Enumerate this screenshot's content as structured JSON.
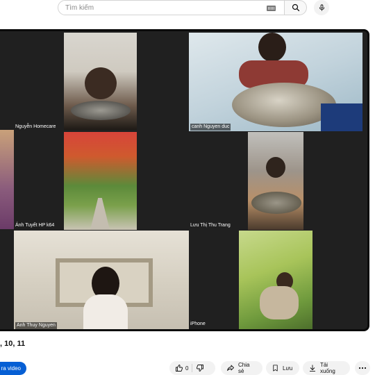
{
  "search": {
    "placeholder": "Tìm kiếm"
  },
  "participants": [
    "Nguyễn Homecare",
    "canh Nguyen duc",
    "Ánh Tuyết HP k64",
    "Lưu Thị Thu Trang",
    "Anh Thuy Nguyen",
    "iPhone"
  ],
  "video_title": ", 10, 11",
  "actions": {
    "subscribe": "ra video",
    "like_count": "0",
    "share": "Chia sẻ",
    "save": "Lưu",
    "download": "Tải xuống"
  },
  "icons": [
    "keyboard-icon",
    "search-icon",
    "mic-icon",
    "like-icon",
    "dislike-icon",
    "share-icon",
    "save-icon",
    "download-icon",
    "more-icon"
  ],
  "colors": {
    "subscribe_bg": "#065fd4",
    "pill_bg": "#f2f2f2",
    "video_bg": "#202020"
  }
}
